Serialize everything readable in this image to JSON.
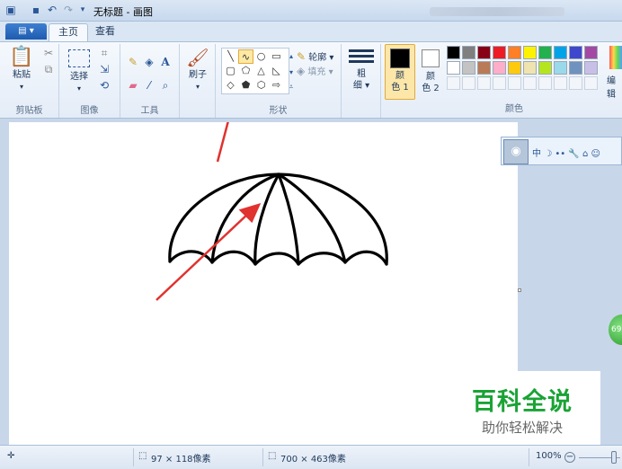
{
  "window": {
    "title": "无标题 - 画图"
  },
  "quick_access": {
    "icons": [
      "paint-app-icon",
      "save-icon",
      "undo-icon",
      "redo-icon",
      "customize-dropdown-icon"
    ]
  },
  "tabs": {
    "home": "主页",
    "view": "查看"
  },
  "ribbon": {
    "clipboard": {
      "paste": "粘贴",
      "title": "剪贴板"
    },
    "image": {
      "select": "选择",
      "title": "图像"
    },
    "tools": {
      "title": "工具"
    },
    "brushes": {
      "label": "刷子"
    },
    "shapes": {
      "outline": "轮廓",
      "fill": "填充",
      "title": "形状"
    },
    "size": {
      "line1": "粗",
      "line2": "细"
    },
    "color1": {
      "line1": "颜",
      "line2": "色 1"
    },
    "color2": {
      "line1": "颜",
      "line2": "色 2"
    },
    "colors": {
      "title": "颜色",
      "edit": "编辑",
      "row1": [
        "#000000",
        "#7f7f7f",
        "#880015",
        "#ed1c24",
        "#ff7f27",
        "#fff200",
        "#22b14c",
        "#00a2e8",
        "#3f48cc",
        "#a349a4"
      ],
      "row2": [
        "#ffffff",
        "#c3c3c3",
        "#b97a57",
        "#ffaec9",
        "#ffc90e",
        "#efe4b0",
        "#b5e61d",
        "#99d9ea",
        "#7092be",
        "#c8bfe7"
      ]
    }
  },
  "qq_toolbar": {
    "items": [
      "中",
      "☽",
      "••",
      "🔧",
      "⌂",
      "☺"
    ]
  },
  "side_badge": "69",
  "watermark": {
    "line1": "百科全说",
    "line2": "助你轻松解决"
  },
  "status": {
    "cursor": "97 × 118像素",
    "canvas": "700 × 463像素",
    "zoom": "100%"
  }
}
